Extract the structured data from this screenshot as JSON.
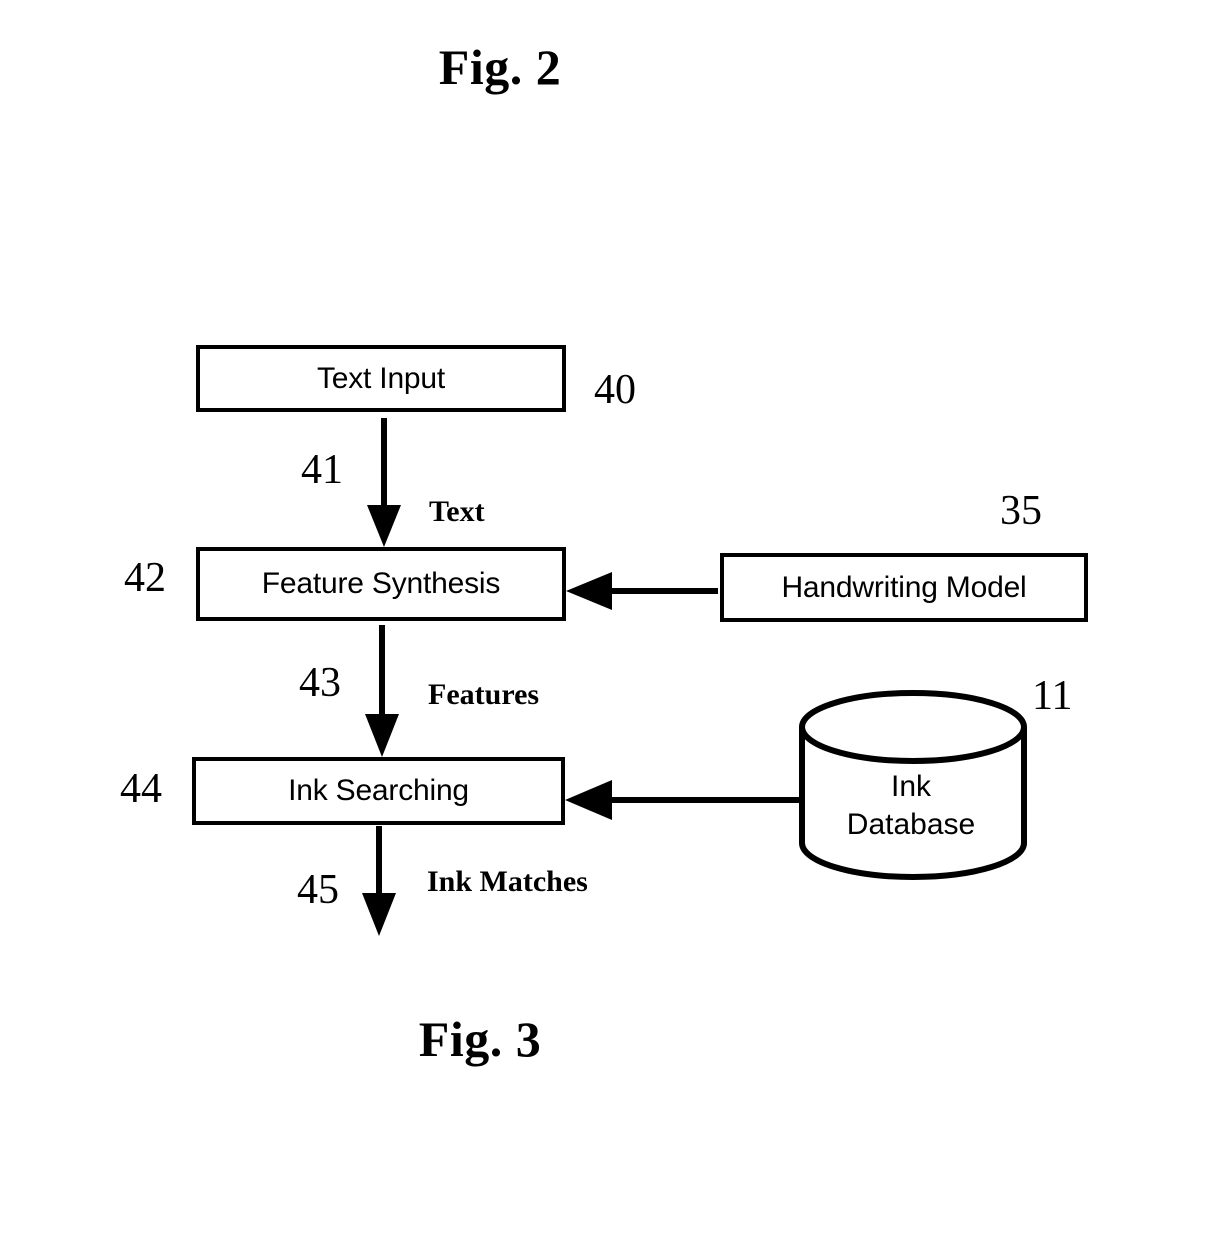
{
  "figure": {
    "top_caption": "Fig. 2",
    "bottom_caption": "Fig. 3"
  },
  "blocks": {
    "text_input": {
      "label": "Text Input",
      "ref": "40"
    },
    "feature_synthesis": {
      "label": "Feature Synthesis",
      "ref": "42"
    },
    "handwriting_model": {
      "label": "Handwriting Model",
      "ref": "35"
    },
    "ink_searching": {
      "label": "Ink Searching",
      "ref": "44"
    },
    "ink_database": {
      "line1": "Ink",
      "line2": "Database",
      "ref": "11"
    }
  },
  "edges": {
    "text_flow": {
      "ref": "41",
      "label": "Text"
    },
    "features_flow": {
      "ref": "43",
      "label": "Features"
    },
    "ink_matches_flow": {
      "ref": "45",
      "label": "Ink Matches"
    }
  },
  "colors": {
    "ink": "#000000",
    "paper": "#ffffff"
  }
}
